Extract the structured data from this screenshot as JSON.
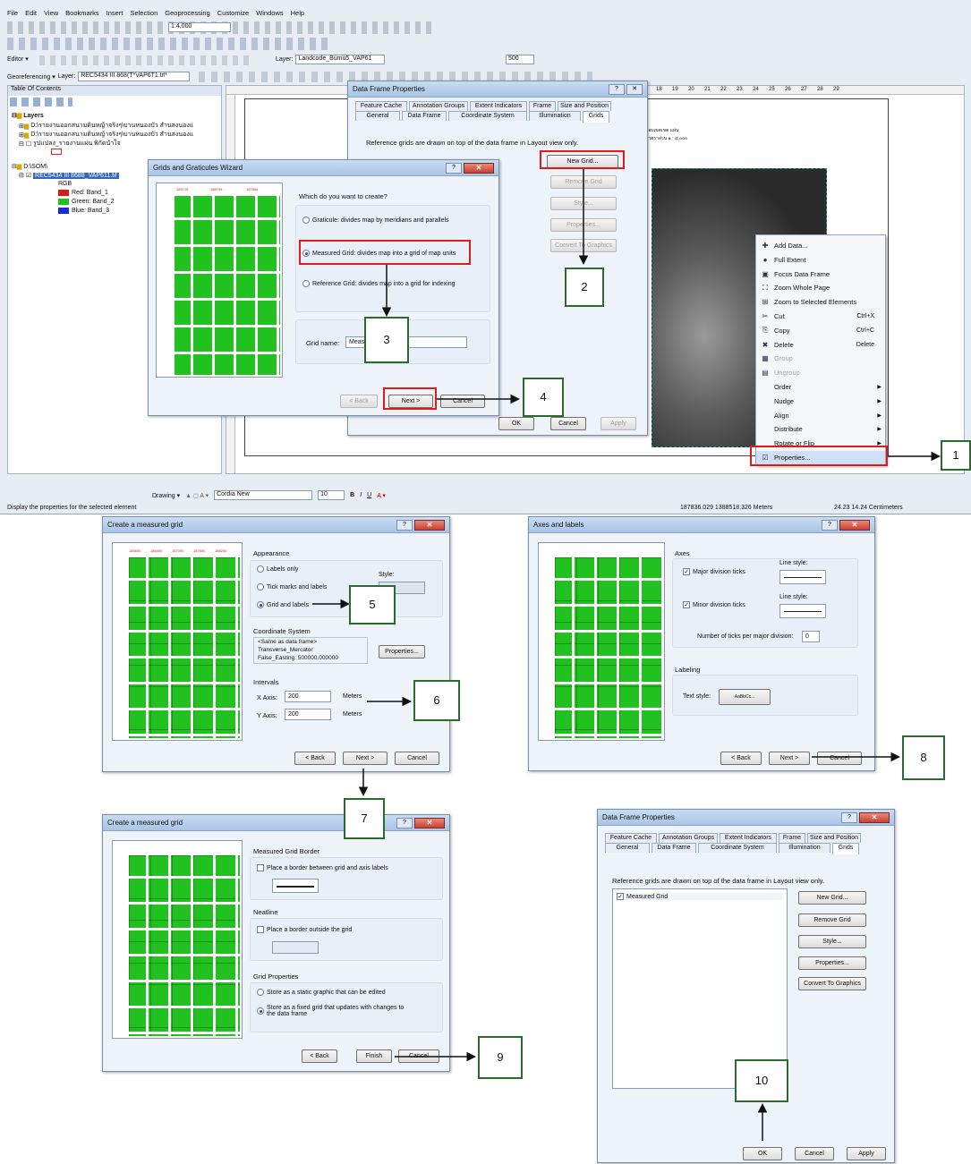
{
  "menubar": [
    "File",
    "Edit",
    "View",
    "Bookmarks",
    "Insert",
    "Selection",
    "Geoprocessing",
    "Customize",
    "Windows",
    "Help"
  ],
  "toolbar": {
    "scale": "1:4,000",
    "layer_label": "Layer:",
    "layer_value": "Landcode_Bumu5_VAP61",
    "zoom": "500",
    "editor": "Editor ▾",
    "georef": "Georeferencing ▾",
    "georef_layer_label": "Layer:",
    "georef_layer": "REC5434 III 868(T*VAP6T1.tif*"
  },
  "toc": {
    "title": "Table Of Contents",
    "layers": "Layers",
    "item1": "D:\\รายงานออกสนามดินหญ้าจริงๆ\\บานหนองบัว สำนสงนองแ",
    "item2": "D:\\รายงานออกสนามดินหญ้าจริงๆ\\บานหนองบัว สำนสงนองแ",
    "item3": "รูปแปลง_รายงานแผ่น พิกัดนำใจ",
    "dir": "D:\\SOM\\",
    "raster": "REC5434 III 8688_VAP611.tif",
    "rgb": "RGB",
    "red": "Red:  Band_1",
    "green": "Green: Band_2",
    "blue": "Blue:  Band_3"
  },
  "ruler_nums": [
    "18",
    "19",
    "20",
    "21",
    "22",
    "23",
    "24",
    "25",
    "26",
    "27",
    "28",
    "29"
  ],
  "layout_text": {
    "line1": "ขอบเขตเขต แผ่น",
    "line2": "มาตราส่วน ๑ : ๔,๐๐๐"
  },
  "dfp1": {
    "title": "Data Frame Properties",
    "tabs_top": [
      "Feature Cache",
      "Annotation Groups",
      "Extent Indicators",
      "Frame",
      "Size and Position"
    ],
    "tabs_bottom": [
      "General",
      "Data Frame",
      "Coordinate System",
      "Illumination",
      "Grids"
    ],
    "desc": "Reference grids are drawn on top of the data frame in Layout view only.",
    "new_grid": "New Grid...",
    "remove_grid": "Remove Grid",
    "style": "Style...",
    "properties": "Properties...",
    "convert": "Convert To Graphics",
    "ok": "OK",
    "cancel": "Cancel",
    "apply": "Apply"
  },
  "wizard": {
    "title": "Grids and Graticules Wizard",
    "question": "Which do you want to create?",
    "opt1": "Graticule: divides map by meridians and parallels",
    "opt2": "Measured Grid: divides map into a grid of map units",
    "opt3": "Reference Grid: divides map into a grid for indexing",
    "grid_name_label": "Grid name:",
    "grid_name_value": "Measured Grid",
    "back": "< Back",
    "next": "Next >",
    "cancel": "Cancel",
    "preview_ticks": [
      "189715",
      "188799",
      "187806"
    ]
  },
  "context_menu": [
    {
      "label": "Add Data...",
      "icon": "✚",
      "shortcut": "",
      "arrow": false,
      "disabled": false
    },
    {
      "label": "Full Extent",
      "icon": "●",
      "shortcut": "",
      "arrow": false,
      "disabled": false
    },
    {
      "label": "Focus Data Frame",
      "icon": "▣",
      "shortcut": "",
      "arrow": false,
      "disabled": false
    },
    {
      "label": "Zoom Whole Page",
      "icon": "⛶",
      "shortcut": "",
      "arrow": false,
      "disabled": false
    },
    {
      "label": "Zoom to Selected Elements",
      "icon": "⊞",
      "shortcut": "",
      "arrow": false,
      "disabled": false
    },
    {
      "label": "Cut",
      "icon": "✂",
      "shortcut": "Ctrl+X",
      "arrow": false,
      "disabled": false
    },
    {
      "label": "Copy",
      "icon": "⎘",
      "shortcut": "Ctrl+C",
      "arrow": false,
      "disabled": false
    },
    {
      "label": "Delete",
      "icon": "✖",
      "shortcut": "Delete",
      "arrow": false,
      "disabled": false
    },
    {
      "label": "Group",
      "icon": "▦",
      "shortcut": "",
      "arrow": false,
      "disabled": true
    },
    {
      "label": "Ungroup",
      "icon": "▤",
      "shortcut": "",
      "arrow": false,
      "disabled": true
    },
    {
      "label": "Order",
      "icon": "",
      "shortcut": "",
      "arrow": true,
      "disabled": false
    },
    {
      "label": "Nudge",
      "icon": "",
      "shortcut": "",
      "arrow": true,
      "disabled": false
    },
    {
      "label": "Align",
      "icon": "",
      "shortcut": "",
      "arrow": true,
      "disabled": false
    },
    {
      "label": "Distribute",
      "icon": "",
      "shortcut": "",
      "arrow": true,
      "disabled": false
    },
    {
      "label": "Rotate or Flip",
      "icon": "",
      "shortcut": "",
      "arrow": true,
      "disabled": false
    },
    {
      "label": "Properties...",
      "icon": "☑",
      "shortcut": "",
      "arrow": false,
      "disabled": false
    }
  ],
  "drawing_bar": {
    "drawing": "Drawing ▾",
    "font": "Cordia New",
    "size": "10"
  },
  "statusbar": {
    "message": "Display the properties for the selected element",
    "coords": "187836.029  1388518.326 Meters",
    "page": "24.23  14.24 Centimeters"
  },
  "cmg1": {
    "title": "Create a measured grid",
    "appearance": "Appearance",
    "labels_only": "Labels only",
    "tick_labels": "Tick marks and labels",
    "grid_labels": "Grid and labels",
    "style": "Style:",
    "coord_sys": "Coordinate System",
    "coord_line1": "<Same as data frame>",
    "coord_line2": "Transverse_Mercator",
    "coord_line3": "False_Easting: 500000.000000",
    "properties": "Properties...",
    "intervals": "Intervals",
    "x_axis": "X Axis:",
    "x_val": "200",
    "y_axis": "Y Axis:",
    "y_val": "200",
    "meters": "Meters",
    "back": "< Back",
    "next": "Next >",
    "cancel": "Cancel",
    "preview_ticks": [
      "185600",
      "186400",
      "187000",
      "187600",
      "188200"
    ]
  },
  "axes": {
    "title": "Axes and labels",
    "axes": "Axes",
    "major": "Major division ticks",
    "minor": "Minor division ticks",
    "line_style": "Line style:",
    "ticks_per": "Number of ticks per major division:",
    "ticks_val": "0",
    "labeling": "Labeling",
    "text_style": "Text style:",
    "text_sample": "AaBbCc...",
    "back": "< Back",
    "next": "Next >",
    "cancel": "Cancel"
  },
  "cmg2": {
    "title": "Create a measured grid",
    "border": "Measured Grid Border",
    "border_opt": "Place a border between grid and axis labels",
    "neatline": "Neatline",
    "neatline_opt": "Place a border outside the grid",
    "grid_props": "Grid Properties",
    "static": "Store as a static graphic that can be edited",
    "fixed1": "Store as a fixed grid that updates with changes to",
    "fixed2": "the data frame",
    "back": "< Back",
    "finish": "Finish",
    "cancel": "Cancel"
  },
  "dfp2": {
    "title": "Data Frame Properties",
    "desc": "Reference grids are drawn on top of the data frame in Layout view only.",
    "grid_item": "Measured Grid",
    "new_grid": "New Grid...",
    "remove_grid": "Remove Grid",
    "style": "Style...",
    "properties": "Properties...",
    "convert": "Convert To Graphics",
    "ok": "OK",
    "cancel": "Cancel",
    "apply": "Apply"
  },
  "steps": [
    "1",
    "2",
    "3",
    "4",
    "5",
    "6",
    "7",
    "8",
    "9",
    "10"
  ],
  "colors": {
    "red_box": "#e01a1a",
    "step_border": "#2d6a2d",
    "map_green": "#21c21f"
  }
}
